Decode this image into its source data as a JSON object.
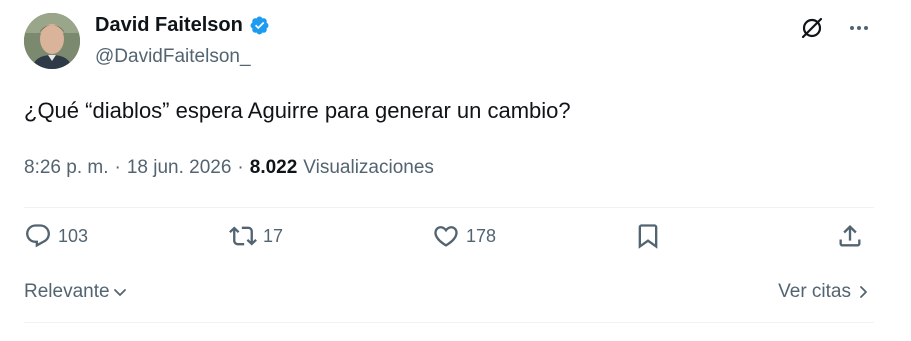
{
  "author": {
    "display_name": "David Faitelson",
    "handle": "@DavidFaitelson_"
  },
  "tweet": {
    "text": "¿Qué “diablos” espera Aguirre para generar un cambio?",
    "time": "8:26 p. m.",
    "sep1": "·",
    "date": "18 jun. 2026",
    "sep2": "·",
    "views_count": "8.022",
    "views_label": "Visualizaciones"
  },
  "actions": {
    "replies": "103",
    "retweets": "17",
    "likes": "178"
  },
  "footer": {
    "sort_label": "Relevante",
    "quotes_label": "Ver citas"
  },
  "icons": [
    "grok-icon",
    "more-icon",
    "verified-icon",
    "reply-icon",
    "retweet-icon",
    "like-icon",
    "bookmark-icon",
    "share-icon",
    "chevron-down-icon",
    "chevron-right-icon"
  ],
  "colors": {
    "verified": "#1d9bf0",
    "muted": "#536471",
    "text": "#0f1419"
  }
}
